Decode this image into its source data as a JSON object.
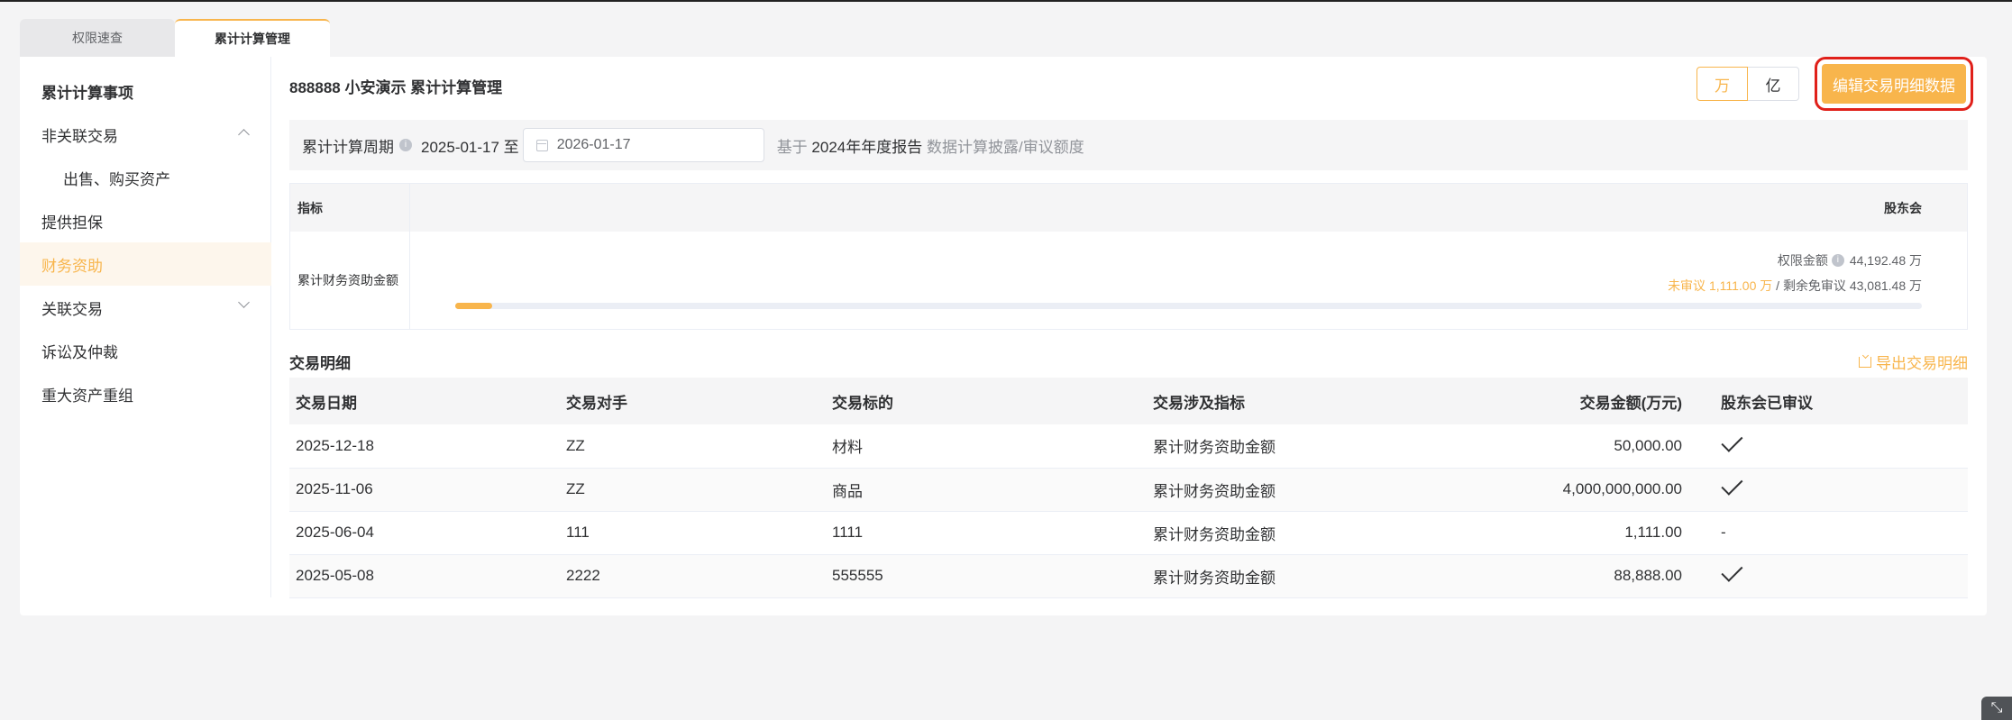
{
  "tabs": [
    {
      "label": "权限速查",
      "active": false
    },
    {
      "label": "累计计算管理",
      "active": true
    }
  ],
  "sidebar": {
    "title": "累计计算事项",
    "items": [
      {
        "label": "非关联交易",
        "expanded": true
      },
      {
        "label": "出售、购买资产"
      },
      {
        "label": "提供担保"
      },
      {
        "label": "财务资助",
        "active": true
      },
      {
        "label": "关联交易",
        "expanded": false
      },
      {
        "label": "诉讼及仲裁"
      },
      {
        "label": "重大资产重组"
      }
    ]
  },
  "header": {
    "title": "888888 小安演示 累计计算管理",
    "unit_wan": "万",
    "unit_yi": "亿",
    "edit_button": "编辑交易明细数据"
  },
  "period": {
    "label": "累计计算周期",
    "start": "2025-01-17 至",
    "end": "2026-01-17",
    "note_prefix": "基于",
    "note_report": "2024年年度报告",
    "note_suffix": "数据计算披露/审议额度"
  },
  "indicator": {
    "col_indicator": "指标",
    "col_body": "股东会",
    "row_label": "累计财务资助金额",
    "limit_label": "权限金额",
    "limit_value": "44,192.48 万",
    "pending_label": "未审议",
    "pending_value": "1,111.00 万",
    "separator": "/",
    "remaining_label": "剩余免审议",
    "remaining_value": "43,081.48 万",
    "progress_fraction": 0.025,
    "accent_color": "#f8b54c"
  },
  "transactions": {
    "title": "交易明细",
    "export_label": "导出交易明细",
    "columns": [
      "交易日期",
      "交易对手",
      "交易标的",
      "交易涉及指标",
      "交易金额(万元)",
      "股东会已审议"
    ],
    "rows": [
      {
        "date": "2025-12-18",
        "party": "ZZ",
        "subject": "材料",
        "indicator": "累计财务资助金额",
        "amount": "50,000.00",
        "approved": "check"
      },
      {
        "date": "2025-11-06",
        "party": "ZZ",
        "subject": "商品",
        "indicator": "累计财务资助金额",
        "amount": "4,000,000,000.00",
        "approved": "check"
      },
      {
        "date": "2025-06-04",
        "party": "111",
        "subject": "1111",
        "indicator": "累计财务资助金额",
        "amount": "1,111.00",
        "approved": "-"
      },
      {
        "date": "2025-05-08",
        "party": "2222",
        "subject": "555555",
        "indicator": "累计财务资助金额",
        "amount": "88,888.00",
        "approved": "check"
      }
    ]
  },
  "corner_icon": "collapse-arrow-icon"
}
